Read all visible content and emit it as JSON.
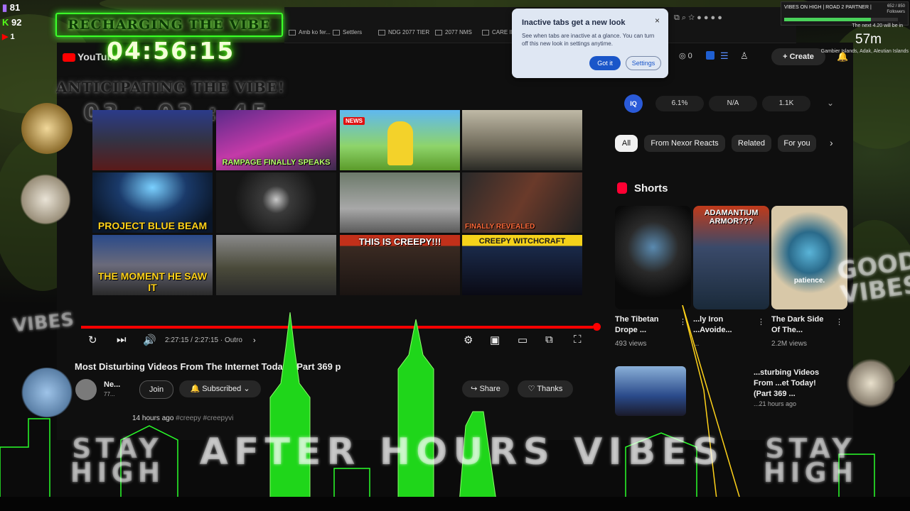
{
  "stream": {
    "twitch_viewers": "81",
    "kick_viewers": "92",
    "youtube_viewers": "1",
    "recharging_label": "RECHARGING THE VIBE",
    "countdown_main": "04:56:15",
    "anticipating_label": "ANTICIPATING THE VIBE!",
    "countdown_secondary": "03 : 03 : 45",
    "badge_title": "VIBES ON HIGH | ROAD 2 PARTNER |",
    "followers_count": "652 / 850",
    "followers_label": "Followers",
    "next_label": "The next 4.20 will be in",
    "next_minutes": "57m",
    "next_location": "Gambier Islands, Adak, Aleutian Islands",
    "overlay_stay_high": "STAY HIGH",
    "overlay_after_hours": "AFTER HOURS VIBES",
    "good_vibes": "GOOD VIBES",
    "vibes_left": "VIBES"
  },
  "browser": {
    "bookmarks": [
      "Amb ko fer...",
      "Settlers",
      "NDG 2077 TIER",
      "2077 NMS",
      "CARE INFO"
    ],
    "youtube_logo": "YouTube"
  },
  "popup": {
    "title": "Inactive tabs get a new look",
    "body": "See when tabs are inactive at a glance. You can turn off this new look in settings anytime.",
    "got_it": "Got it",
    "settings": "Settings"
  },
  "header": {
    "create_label": "Create"
  },
  "grid": {
    "captions": [
      "",
      "RAMPAGE FINALLY SPEAKS",
      "",
      "",
      "PROJECT BLUE BEAM",
      "",
      "",
      "FINALLY REVEALED",
      "THE MOMENT HE SAW IT",
      "",
      "THIS IS CREEPY!!!",
      "CREEPY WITCHCRAFT"
    ],
    "badge_news": "NEWS"
  },
  "player": {
    "time": "2:27:15 / 2:27:15 · Outro",
    "title": "Most Disturbing Videos From The Internet Today! (Part 369 p",
    "channel": "Ne...",
    "channel_subs": "77...",
    "join": "Join",
    "subscribed": "Subscribed",
    "share": "Share",
    "thanks": "Thanks",
    "posted": "14 hours ago",
    "hashtags": "#creepy #creepyvi"
  },
  "sidebar": {
    "stats": [
      "6.1%",
      "N/A",
      "1.1K"
    ],
    "chips": [
      "All",
      "From Nexor Reacts",
      "Related",
      "For you"
    ],
    "shorts_label": "Shorts",
    "shorts": [
      {
        "title": "The Tibetan Drope ...",
        "views": "493 views",
        "overlay": ""
      },
      {
        "title": "...ly Iron ...Avoide...",
        "views": "...",
        "overlay": "ADAMANTIUM ARMOR???"
      },
      {
        "title": "The Dark Side Of The...",
        "views": "2.2M views",
        "overlay": "patience."
      }
    ],
    "next_video_title": "...sturbing Videos From ...et Today! (Part 369 ...",
    "next_video_time": "...21 hours ago"
  },
  "colors": {
    "neon_green": "#3cff2a",
    "yt_red": "#ff0000",
    "popup_bg": "#dfe7f3",
    "popup_button": "#1a56c9"
  }
}
